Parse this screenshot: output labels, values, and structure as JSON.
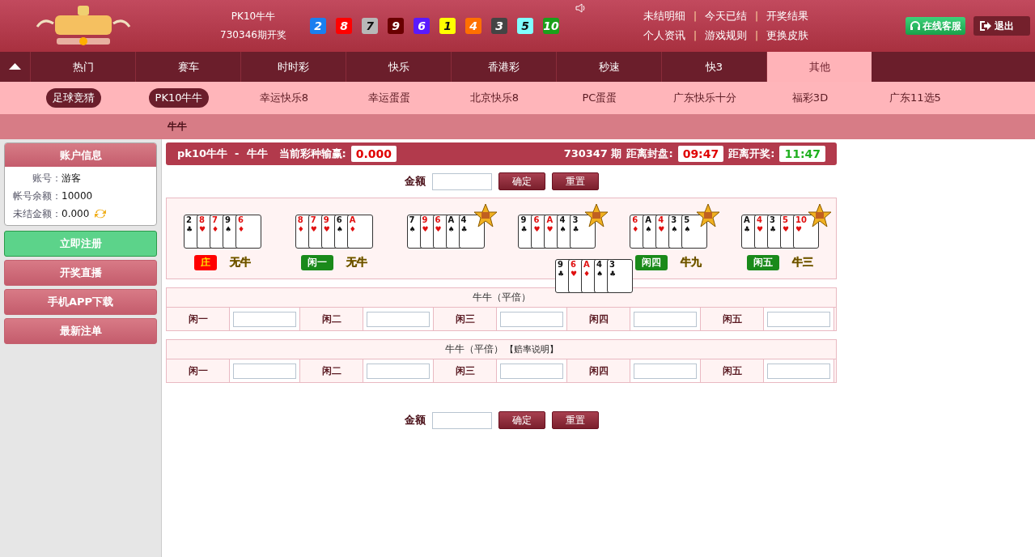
{
  "header": {
    "game": "PK10牛牛",
    "draw": "730346期开奖",
    "balls": [
      {
        "n": "2",
        "color": "#1a7ff0"
      },
      {
        "n": "8",
        "color": "#ff0000"
      },
      {
        "n": "7",
        "color": "#b8b8b8"
      },
      {
        "n": "9",
        "color": "#6a0000"
      },
      {
        "n": "6",
        "color": "#5a1aff"
      },
      {
        "n": "1",
        "color": "#ffff00"
      },
      {
        "n": "4",
        "color": "#ff7000"
      },
      {
        "n": "3",
        "color": "#444444"
      },
      {
        "n": "5",
        "color": "#80ffff"
      },
      {
        "n": "10",
        "color": "#1aa01a"
      }
    ],
    "links": [
      [
        "未结明细",
        "今天已结",
        "开奖结果"
      ],
      [
        "个人资讯",
        "游戏规则",
        "更换皮肤"
      ]
    ],
    "separator": "|",
    "service": "在线客服",
    "logout": "退出"
  },
  "nav": [
    {
      "label": "热门",
      "selected": false
    },
    {
      "label": "赛车",
      "selected": false
    },
    {
      "label": "时时彩",
      "selected": false
    },
    {
      "label": "快乐",
      "selected": false
    },
    {
      "label": "香港彩",
      "selected": false
    },
    {
      "label": "秒速",
      "selected": false
    },
    {
      "label": "快3",
      "selected": false
    },
    {
      "label": "其他",
      "selected": true
    }
  ],
  "subnav": [
    {
      "label": "足球竞猜",
      "selected": true
    },
    {
      "label": "PK10牛牛",
      "selected": true
    },
    {
      "label": "幸运快乐8",
      "selected": false
    },
    {
      "label": "幸运蛋蛋",
      "selected": false
    },
    {
      "label": "北京快乐8",
      "selected": false
    },
    {
      "label": "PC蛋蛋",
      "selected": false
    },
    {
      "label": "广东快乐十分",
      "selected": false
    },
    {
      "label": "福彩3D",
      "selected": false
    },
    {
      "label": "广东11选5",
      "selected": false
    }
  ],
  "breadcrumb": "牛牛",
  "sidebar": {
    "title": "账户信息",
    "rows": [
      {
        "label": "账号：",
        "value": "游客"
      },
      {
        "label": "帐号余额：",
        "value": "10000"
      },
      {
        "label": "未结金额：",
        "value": "0.000"
      }
    ],
    "buttons": [
      {
        "label": "立即注册",
        "kind": "primary"
      },
      {
        "label": "开奖直播",
        "kind": "normal"
      },
      {
        "label": "手机APP下载",
        "kind": "normal"
      },
      {
        "label": "最新注单",
        "kind": "normal"
      }
    ]
  },
  "status": {
    "title": "pk10牛牛  -  牛牛",
    "profit_label": "当前彩种输赢:",
    "profit": "0.000",
    "period": "730347 期",
    "close_label": "距离封盘:",
    "close": "09:47",
    "open_label": "距离开奖:",
    "open": "11:47"
  },
  "amount": {
    "label": "金额",
    "confirm": "确定",
    "reset": "重置"
  },
  "hands": [
    {
      "cards": [
        {
          "rank": "2",
          "suit": "♣",
          "red": false
        },
        {
          "rank": "8",
          "suit": "♥",
          "red": true
        },
        {
          "rank": "7",
          "suit": "♦",
          "red": true
        },
        {
          "rank": "9",
          "suit": "♠",
          "red": false
        },
        {
          "rank": "6",
          "suit": "♦",
          "red": true
        }
      ],
      "winner": false,
      "player": {
        "label": "庄",
        "kind": "banker"
      },
      "result": "无牛"
    },
    {
      "cards": [
        {
          "rank": "8",
          "suit": "♦",
          "red": true
        },
        {
          "rank": "7",
          "suit": "♥",
          "red": true
        },
        {
          "rank": "9",
          "suit": "♥",
          "red": true
        },
        {
          "rank": "6",
          "suit": "♠",
          "red": false
        },
        {
          "rank": "A",
          "suit": "♦",
          "red": true
        }
      ],
      "winner": false,
      "player": {
        "label": "闲一",
        "kind": "player"
      },
      "result": "无牛"
    },
    {
      "cards": [
        {
          "rank": "7",
          "suit": "♠",
          "red": false
        },
        {
          "rank": "9",
          "suit": "♥",
          "red": true
        },
        {
          "rank": "6",
          "suit": "♥",
          "red": true
        },
        {
          "rank": "A",
          "suit": "♠",
          "red": false
        },
        {
          "rank": "4",
          "suit": "♣",
          "red": false
        }
      ],
      "winner": true
    },
    {
      "cards": [
        {
          "rank": "9",
          "suit": "♣",
          "red": false
        },
        {
          "rank": "6",
          "suit": "♥",
          "red": true
        },
        {
          "rank": "A",
          "suit": "♥",
          "red": true
        },
        {
          "rank": "4",
          "suit": "♠",
          "red": false
        },
        {
          "rank": "3",
          "suit": "♣",
          "red": false
        }
      ],
      "winner": true
    },
    {
      "cards": [
        {
          "rank": "6",
          "suit": "♦",
          "red": true
        },
        {
          "rank": "A",
          "suit": "♠",
          "red": false
        },
        {
          "rank": "4",
          "suit": "♥",
          "red": true
        },
        {
          "rank": "3",
          "suit": "♠",
          "red": false
        },
        {
          "rank": "5",
          "suit": "♠",
          "red": false
        }
      ],
      "winner": true,
      "player": {
        "label": "闲四",
        "kind": "player"
      },
      "result": "牛九"
    },
    {
      "cards": [
        {
          "rank": "A",
          "suit": "♣",
          "red": false
        },
        {
          "rank": "4",
          "suit": "♥",
          "red": true
        },
        {
          "rank": "3",
          "suit": "♣",
          "red": false
        },
        {
          "rank": "5",
          "suit": "♥",
          "red": true
        },
        {
          "rank": "10",
          "suit": "♥",
          "red": true
        }
      ],
      "winner": true,
      "player": {
        "label": "闲五",
        "kind": "player"
      },
      "result": "牛三"
    }
  ],
  "floating_cards": [
    {
      "rank": "9",
      "suit": "♣",
      "red": false
    },
    {
      "rank": "6",
      "suit": "♥",
      "red": true
    },
    {
      "rank": "A",
      "suit": "♦",
      "red": true
    },
    {
      "rank": "4",
      "suit": "♠",
      "red": false
    },
    {
      "rank": "3",
      "suit": "♣",
      "red": false
    }
  ],
  "bet_tables": [
    {
      "title": "牛牛（平倍）",
      "cells": [
        "闲一",
        "闲二",
        "闲三",
        "闲四",
        "闲五"
      ]
    },
    {
      "title": "牛牛（平倍）",
      "link": "【赔率说明】",
      "cells": [
        "闲一",
        "闲二",
        "闲三",
        "闲四",
        "闲五"
      ]
    }
  ],
  "amount_bottom": {
    "label": "金额",
    "confirm": "确定",
    "reset": "重置"
  }
}
